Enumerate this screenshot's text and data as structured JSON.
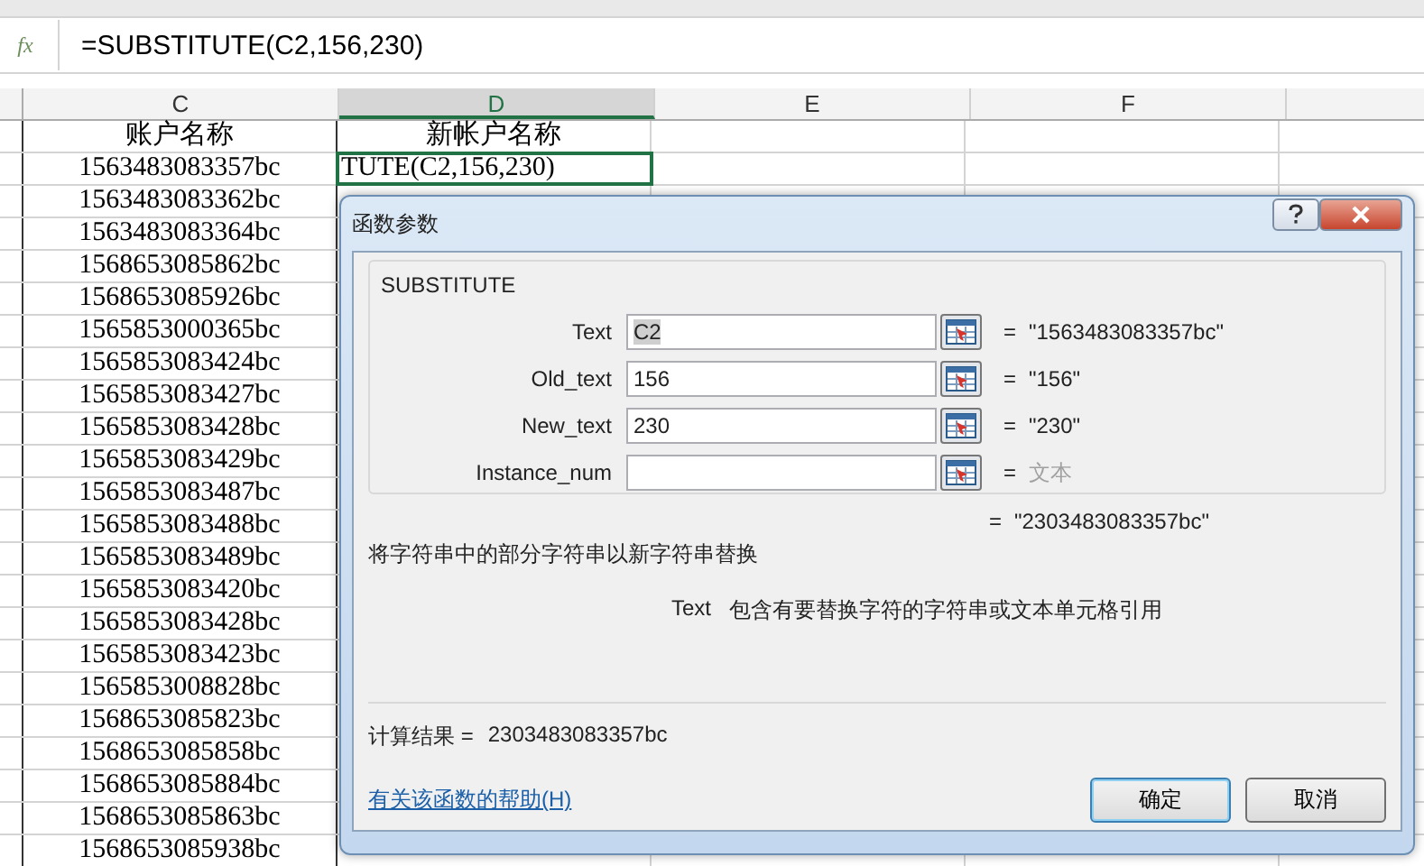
{
  "formula_bar": {
    "function_label": "fx",
    "formula": "=SUBSTITUTE(C2,156,230)"
  },
  "columns": [
    {
      "label": "C",
      "selected": false
    },
    {
      "label": "D",
      "selected": true
    },
    {
      "label": "E",
      "selected": false
    },
    {
      "label": "F",
      "selected": false
    }
  ],
  "rows": [
    {
      "cells": [
        {
          "text": "账户名称",
          "selected": false
        },
        {
          "text": "新帐户名称",
          "selected": false
        }
      ]
    },
    {
      "cells": [
        {
          "text": "1563483083357bc",
          "selected": false
        },
        {
          "text": "TUTE(C2,156,230)",
          "selected": true
        }
      ]
    },
    {
      "cells": [
        {
          "text": "1563483083362bc",
          "selected": false
        }
      ]
    },
    {
      "cells": [
        {
          "text": "1563483083364bc",
          "selected": false
        }
      ]
    },
    {
      "cells": [
        {
          "text": "1568653085862bc",
          "selected": false
        }
      ]
    },
    {
      "cells": [
        {
          "text": "1568653085926bc",
          "selected": false
        }
      ]
    },
    {
      "cells": [
        {
          "text": "1565853000365bc",
          "selected": false
        }
      ]
    },
    {
      "cells": [
        {
          "text": "1565853083424bc",
          "selected": false
        }
      ]
    },
    {
      "cells": [
        {
          "text": "1565853083427bc",
          "selected": false
        }
      ]
    },
    {
      "cells": [
        {
          "text": "1565853083428bc",
          "selected": false
        }
      ]
    },
    {
      "cells": [
        {
          "text": "1565853083429bc",
          "selected": false
        }
      ]
    },
    {
      "cells": [
        {
          "text": "1565853083487bc",
          "selected": false
        }
      ]
    },
    {
      "cells": [
        {
          "text": "1565853083488bc",
          "selected": false
        }
      ]
    },
    {
      "cells": [
        {
          "text": "1565853083489bc",
          "selected": false
        }
      ]
    },
    {
      "cells": [
        {
          "text": "1565853083420bc",
          "selected": false
        }
      ]
    },
    {
      "cells": [
        {
          "text": "1565853083428bc",
          "selected": false
        }
      ]
    },
    {
      "cells": [
        {
          "text": "1565853083423bc",
          "selected": false
        }
      ]
    },
    {
      "cells": [
        {
          "text": "1565853008828bc",
          "selected": false
        }
      ]
    },
    {
      "cells": [
        {
          "text": "1568653085823bc",
          "selected": false
        }
      ]
    },
    {
      "cells": [
        {
          "text": "1568653085858bc",
          "selected": false
        }
      ]
    },
    {
      "cells": [
        {
          "text": "1568653085884bc",
          "selected": false
        }
      ]
    },
    {
      "cells": [
        {
          "text": "1568653085863bc",
          "selected": false
        }
      ]
    },
    {
      "cells": [
        {
          "text": "1568653085938bc",
          "selected": false
        }
      ]
    }
  ],
  "dialog": {
    "title": "函数参数",
    "function_name": "SUBSTITUTE",
    "arguments": [
      {
        "label": "Text",
        "value": "C2",
        "value_selected": true,
        "equals": "=",
        "result": "\"1563483083357bc\"",
        "result_dimmed": false
      },
      {
        "label": "Old_text",
        "value": "156",
        "value_selected": false,
        "equals": "=",
        "result": "\"156\"",
        "result_dimmed": false
      },
      {
        "label": "New_text",
        "value": "230",
        "value_selected": false,
        "equals": "=",
        "result": "\"230\"",
        "result_dimmed": false
      },
      {
        "label": "Instance_num",
        "equals": "=",
        "result": "文本",
        "result_dimmed": true
      }
    ],
    "formula_result": {
      "equals": "=",
      "value": "\"2303483083357bc\""
    },
    "description": "将字符串中的部分字符串以新字符串替换",
    "argument_help": {
      "name": "Text",
      "text": "包含有要替换字符的字符串或文本单元格引用"
    },
    "calc_result": {
      "label": "计算结果 =",
      "value": "2303483083357bc"
    },
    "help_link": "有关该函数的帮助(H)",
    "buttons": [
      {
        "label": "确定",
        "default": true
      },
      {
        "label": "取消",
        "default": false
      }
    ]
  }
}
